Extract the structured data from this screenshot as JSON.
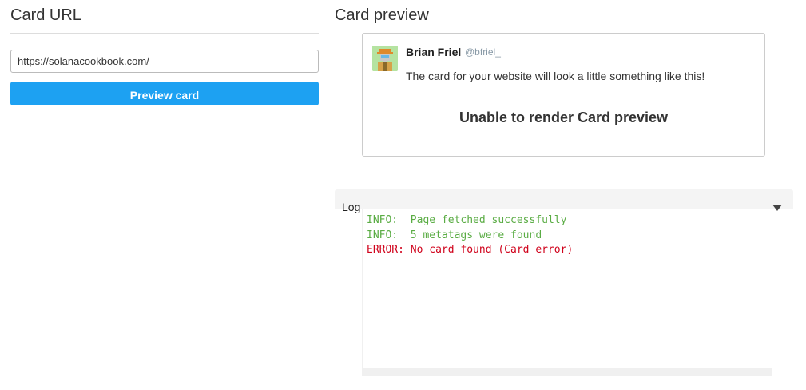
{
  "left": {
    "title": "Card URL",
    "url_input": {
      "value": "https://solanacookbook.com/",
      "placeholder": ""
    },
    "preview_button_label": "Preview card"
  },
  "right": {
    "title": "Card preview",
    "card": {
      "author_name": "Brian Friel",
      "author_handle": "@bfriel_",
      "text": "The card for your website will look a little something like this!",
      "error_message": "Unable to render Card preview"
    },
    "log": {
      "label": "Log",
      "toggle_icon": "caret-down-icon",
      "lines": [
        {
          "level": "info",
          "text": "INFO:  Page fetched successfully"
        },
        {
          "level": "info",
          "text": "INFO:  5 metatags were found"
        },
        {
          "level": "error",
          "text": "ERROR: No card found (Card error)"
        }
      ]
    }
  },
  "colors": {
    "button": "#1da1f2",
    "info": "#5aac44",
    "error": "#d0021b"
  }
}
